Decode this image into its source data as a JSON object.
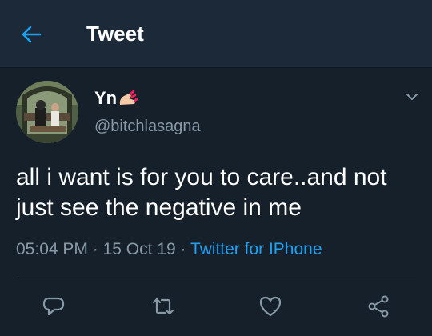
{
  "header": {
    "title": "Tweet",
    "back_icon": "arrow-left-icon",
    "accent": "#1da1f2"
  },
  "tweet": {
    "display_name": "Yn",
    "name_emoji": "nail-polish-emoji",
    "handle": "@bitchlasagna",
    "text": "all i want is for you to care..and not just see the negative in me",
    "time": "05:04 PM",
    "separator": "·",
    "date": "15 Oct 19",
    "source": "Twitter for IPhone",
    "menu_icon": "chevron-down-icon"
  },
  "actions": [
    {
      "name": "reply",
      "icon": "reply-icon"
    },
    {
      "name": "retweet",
      "icon": "retweet-icon"
    },
    {
      "name": "like",
      "icon": "heart-icon"
    },
    {
      "name": "share",
      "icon": "share-icon"
    }
  ],
  "colors": {
    "background": "#15202b",
    "header_background": "#1c2938",
    "secondary_text": "#8899a6",
    "link": "#1da1f2",
    "divider": "#38444d"
  }
}
